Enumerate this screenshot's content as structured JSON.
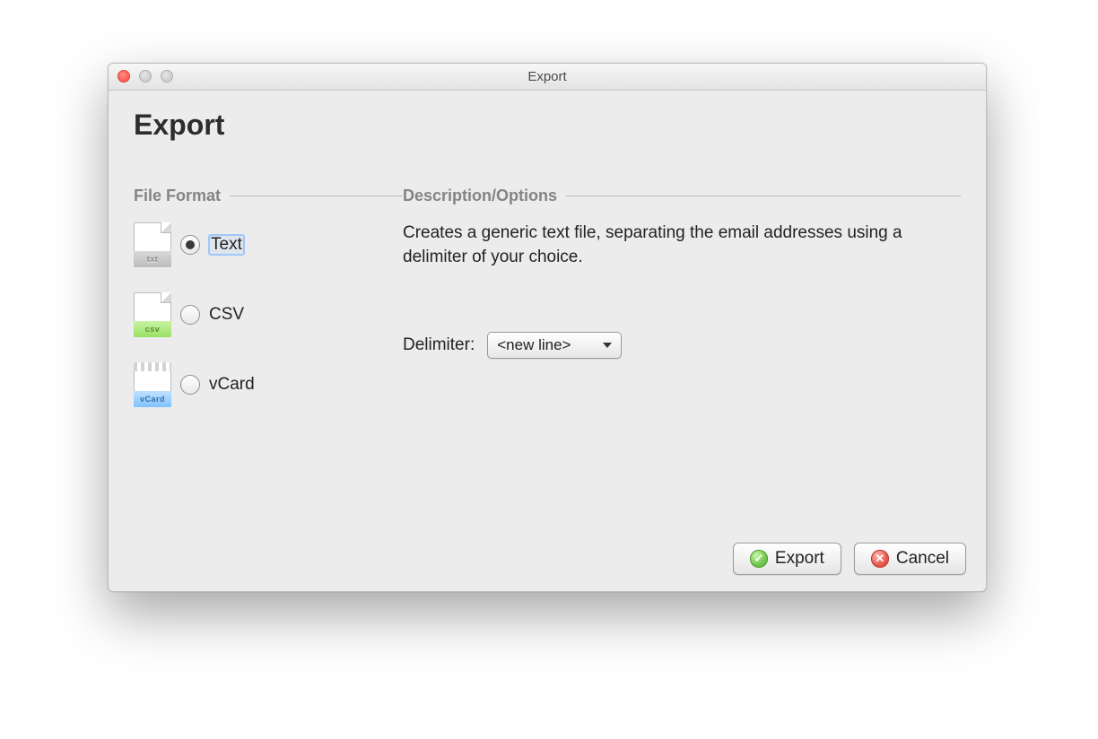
{
  "window": {
    "title": "Export"
  },
  "heading": "Export",
  "sections": {
    "format": "File Format",
    "desc": "Description/Options"
  },
  "formats": {
    "text": {
      "label": "Text",
      "band": "txt",
      "selected": true
    },
    "csv": {
      "label": "CSV",
      "band": "csv",
      "selected": false
    },
    "vcard": {
      "label": "vCard",
      "band": "vCard",
      "selected": false
    }
  },
  "description": "Creates a generic text file, separating the email addresses using a delimiter of your choice.",
  "delimiter": {
    "label": "Delimiter:",
    "value": "<new line>"
  },
  "buttons": {
    "export": "Export",
    "cancel": "Cancel"
  }
}
